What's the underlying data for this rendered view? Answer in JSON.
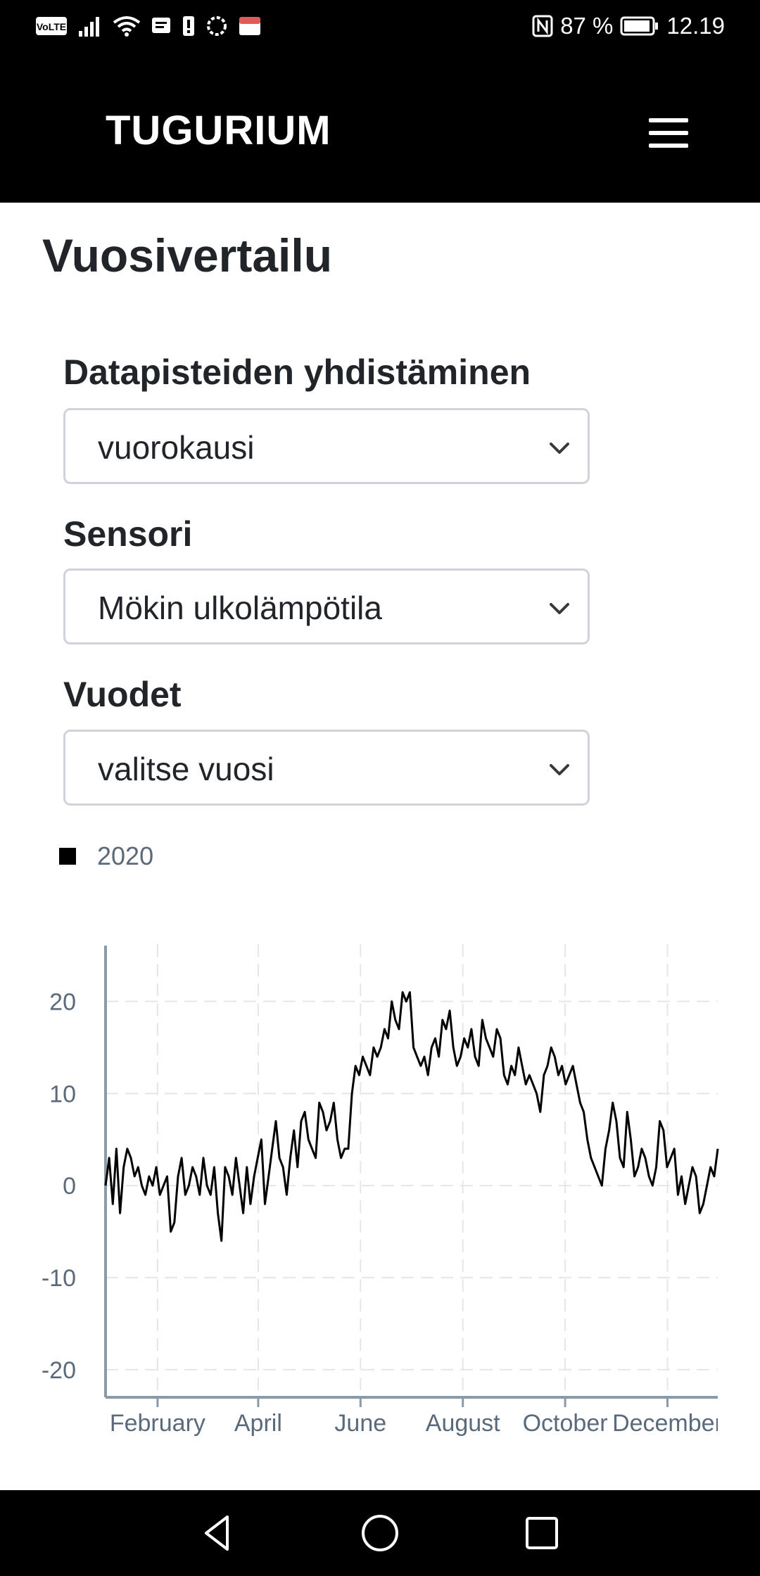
{
  "status_bar": {
    "volte": "VoLTE",
    "battery_percent": "87 %",
    "time": "12.19",
    "icons": [
      "volte-icon",
      "signal-icon",
      "wifi-icon",
      "message-icon",
      "alert-icon",
      "signal-app-icon",
      "app-icon",
      "nfc-icon",
      "battery-icon"
    ]
  },
  "navbar": {
    "brand": "TUGURIUM",
    "menu_icon": "hamburger-icon"
  },
  "page": {
    "title": "Vuosivertailu"
  },
  "form": {
    "aggregation": {
      "label": "Datapisteiden yhdistäminen",
      "value": "vuorokausi"
    },
    "sensor": {
      "label": "Sensori",
      "value": "Mökin ulkolämpötila"
    },
    "years": {
      "label": "Vuodet",
      "value": "valitse vuosi"
    }
  },
  "chart_data": {
    "type": "line",
    "series": [
      {
        "name": "2020",
        "color": "#000000",
        "values": [
          0,
          3,
          -2,
          4,
          -3,
          2,
          4,
          3,
          1,
          2,
          0,
          -1,
          1,
          0,
          2,
          -1,
          0,
          1,
          -5,
          -4,
          1,
          3,
          -1,
          0,
          2,
          1,
          -1,
          3,
          0,
          -1,
          2,
          -3,
          -6,
          2,
          1,
          -1,
          3,
          0,
          -3,
          2,
          -2,
          1,
          3,
          5,
          -2,
          1,
          4,
          7,
          3,
          2,
          -1,
          3,
          6,
          2,
          7,
          8,
          5,
          4,
          3,
          9,
          8,
          6,
          7,
          9,
          5,
          3,
          4,
          4,
          10,
          13,
          12,
          14,
          13,
          12,
          15,
          14,
          15,
          17,
          16,
          20,
          18,
          17,
          21,
          20,
          21,
          15,
          14,
          13,
          14,
          12,
          15,
          16,
          14,
          18,
          17,
          19,
          15,
          13,
          14,
          16,
          15,
          17,
          14,
          13,
          18,
          16,
          15,
          14,
          17,
          16,
          12,
          11,
          13,
          12,
          15,
          13,
          11,
          12,
          11,
          10,
          8,
          12,
          13,
          15,
          14,
          12,
          13,
          11,
          12,
          13,
          11,
          9,
          8,
          5,
          3,
          2,
          1,
          0,
          4,
          6,
          9,
          7,
          3,
          2,
          8,
          5,
          1,
          2,
          4,
          3,
          1,
          0,
          2,
          7,
          6,
          2,
          3,
          4,
          -1,
          1,
          -2,
          0,
          2,
          1,
          -3,
          -2,
          0,
          2,
          1,
          4
        ]
      }
    ],
    "x_start": "2020-01-01",
    "x_end": "2020-12-31",
    "x_ticks": [
      "February",
      "April",
      "June",
      "August",
      "October",
      "December"
    ],
    "y_ticks": [
      20,
      10,
      0,
      -10,
      -20
    ],
    "ylim": [
      -23,
      25
    ],
    "grid": true,
    "legend": "top-left"
  },
  "bottom_nav": {
    "back": "back-icon",
    "home": "home-icon",
    "recents": "recents-icon"
  }
}
